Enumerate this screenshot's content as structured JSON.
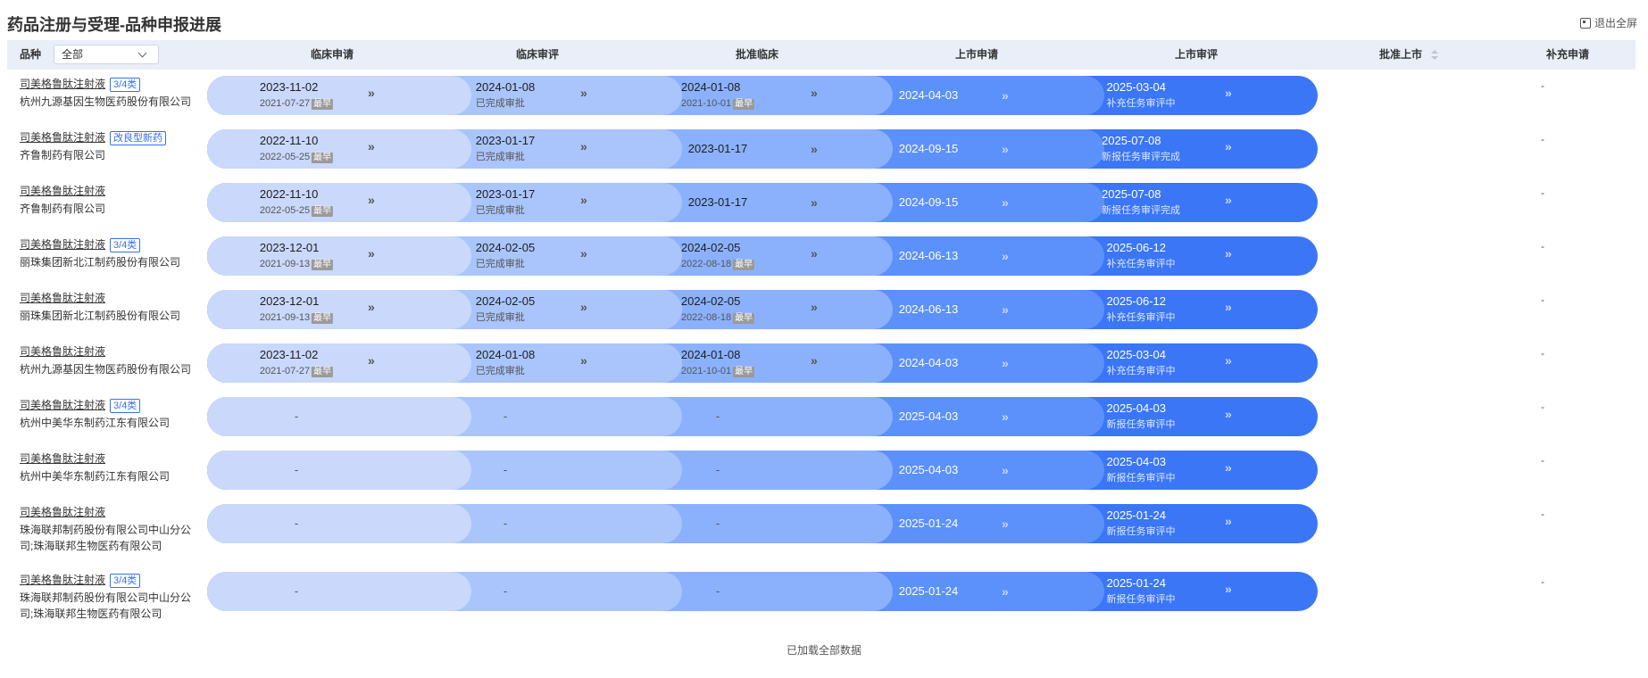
{
  "page": {
    "title": "药品注册与受理-品种申报进展",
    "exit_fullscreen": "退出全屏",
    "footer": "已加载全部数据"
  },
  "header": {
    "variety_label": "品种",
    "select_value": "全部",
    "columns": [
      "临床申请",
      "临床审评",
      "批准临床",
      "上市申请",
      "上市审评",
      "批准上市",
      "补充申请"
    ]
  },
  "earliest_label": "最早",
  "rows": [
    {
      "drug": "司美格鲁肽注射液",
      "tag": "3/4类",
      "company": "杭州九源基因生物医药股份有限公司",
      "c1": {
        "d1": "2023-11-02",
        "d2": "2021-07-27",
        "earliest": true
      },
      "c2": {
        "d1": "2024-01-08",
        "d2": "已完成审批"
      },
      "c3": {
        "d1": "2024-01-08",
        "d2": "2021-10-01",
        "earliest": true
      },
      "c4": {
        "d1": "2024-04-03"
      },
      "c5": {
        "d1": "2025-03-04",
        "d2": "补充任务审评中"
      },
      "supp": "-"
    },
    {
      "drug": "司美格鲁肽注射液",
      "tag": "改良型新药",
      "company": "齐鲁制药有限公司",
      "c1": {
        "d1": "2022-11-10",
        "d2": "2022-05-25",
        "earliest": true
      },
      "c2": {
        "d1": "2023-01-17",
        "d2": "已完成审批"
      },
      "c3": {
        "d1": "2023-01-17"
      },
      "c4": {
        "d1": "2024-09-15"
      },
      "c5": {
        "d1": "2025-07-08",
        "d2": "新报任务审评完成"
      },
      "supp": "-"
    },
    {
      "drug": "司美格鲁肽注射液",
      "tag": "",
      "company": "齐鲁制药有限公司",
      "c1": {
        "d1": "2022-11-10",
        "d2": "2022-05-25",
        "earliest": true
      },
      "c2": {
        "d1": "2023-01-17",
        "d2": "已完成审批"
      },
      "c3": {
        "d1": "2023-01-17"
      },
      "c4": {
        "d1": "2024-09-15"
      },
      "c5": {
        "d1": "2025-07-08",
        "d2": "新报任务审评完成"
      },
      "supp": "-"
    },
    {
      "drug": "司美格鲁肽注射液",
      "tag": "3/4类",
      "company": "丽珠集团新北江制药股份有限公司",
      "c1": {
        "d1": "2023-12-01",
        "d2": "2021-09-13",
        "earliest": true
      },
      "c2": {
        "d1": "2024-02-05",
        "d2": "已完成审批"
      },
      "c3": {
        "d1": "2024-02-05",
        "d2": "2022-08-18",
        "earliest": true
      },
      "c4": {
        "d1": "2024-06-13"
      },
      "c5": {
        "d1": "2025-06-12",
        "d2": "补充任务审评中"
      },
      "supp": "-"
    },
    {
      "drug": "司美格鲁肽注射液",
      "tag": "",
      "company": "丽珠集团新北江制药股份有限公司",
      "c1": {
        "d1": "2023-12-01",
        "d2": "2021-09-13",
        "earliest": true
      },
      "c2": {
        "d1": "2024-02-05",
        "d2": "已完成审批"
      },
      "c3": {
        "d1": "2024-02-05",
        "d2": "2022-08-18",
        "earliest": true
      },
      "c4": {
        "d1": "2024-06-13"
      },
      "c5": {
        "d1": "2025-06-12",
        "d2": "补充任务审评中"
      },
      "supp": "-"
    },
    {
      "drug": "司美格鲁肽注射液",
      "tag": "",
      "company": "杭州九源基因生物医药股份有限公司",
      "c1": {
        "d1": "2023-11-02",
        "d2": "2021-07-27",
        "earliest": true
      },
      "c2": {
        "d1": "2024-01-08",
        "d2": "已完成审批"
      },
      "c3": {
        "d1": "2024-01-08",
        "d2": "2021-10-01",
        "earliest": true
      },
      "c4": {
        "d1": "2024-04-03"
      },
      "c5": {
        "d1": "2025-03-04",
        "d2": "补充任务审评中"
      },
      "supp": "-"
    },
    {
      "drug": "司美格鲁肽注射液",
      "tag": "3/4类",
      "company": "杭州中美华东制药江东有限公司",
      "c1": {
        "d1": "-"
      },
      "c2": {
        "d1": "-"
      },
      "c3": {
        "d1": "-"
      },
      "c4": {
        "d1": "2025-04-03"
      },
      "c5": {
        "d1": "2025-04-03",
        "d2": "新报任务审评中"
      },
      "supp": "-"
    },
    {
      "drug": "司美格鲁肽注射液",
      "tag": "",
      "company": "杭州中美华东制药江东有限公司",
      "c1": {
        "d1": "-"
      },
      "c2": {
        "d1": "-"
      },
      "c3": {
        "d1": "-"
      },
      "c4": {
        "d1": "2025-04-03"
      },
      "c5": {
        "d1": "2025-04-03",
        "d2": "新报任务审评中"
      },
      "supp": "-"
    },
    {
      "drug": "司美格鲁肽注射液",
      "tag": "",
      "company": "珠海联邦制药股份有限公司中山分公司;珠海联邦生物医药有限公司",
      "c1": {
        "d1": "-"
      },
      "c2": {
        "d1": "-"
      },
      "c3": {
        "d1": "-"
      },
      "c4": {
        "d1": "2025-01-24"
      },
      "c5": {
        "d1": "2025-01-24",
        "d2": "新报任务审评中"
      },
      "supp": "-"
    },
    {
      "drug": "司美格鲁肽注射液",
      "tag": "3/4类",
      "company": "珠海联邦制药股份有限公司中山分公司;珠海联邦生物医药有限公司",
      "c1": {
        "d1": "-"
      },
      "c2": {
        "d1": "-"
      },
      "c3": {
        "d1": "-"
      },
      "c4": {
        "d1": "2025-01-24"
      },
      "c5": {
        "d1": "2025-01-24",
        "d2": "新报任务审评中"
      },
      "supp": "-"
    }
  ]
}
